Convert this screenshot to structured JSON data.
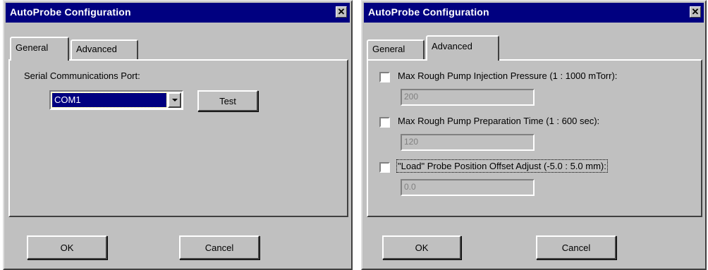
{
  "dialog_general": {
    "title": "AutoProbe Configuration",
    "close_glyph": "✕",
    "tabs": [
      {
        "label": "General",
        "active": true
      },
      {
        "label": "Advanced",
        "active": false
      }
    ],
    "port_label": "Serial Communications Port:",
    "port_value": "COM1",
    "test_label": "Test",
    "ok_label": "OK",
    "cancel_label": "Cancel"
  },
  "dialog_advanced": {
    "title": "AutoProbe Configuration",
    "close_glyph": "✕",
    "tabs": [
      {
        "label": "General",
        "active": false
      },
      {
        "label": "Advanced",
        "active": true
      }
    ],
    "options": [
      {
        "label": "Max Rough Pump Injection Pressure (1 : 1000 mTorr):",
        "value": "200",
        "checked": false
      },
      {
        "label": "Max Rough Pump Preparation Time (1 : 600 sec):",
        "value": "120",
        "checked": false
      },
      {
        "label": "\"Load\" Probe Position Offset Adjust (-5.0 : 5.0 mm):",
        "value": "0.0",
        "checked": false
      }
    ],
    "ok_label": "OK",
    "cancel_label": "Cancel"
  },
  "colors": {
    "title_bar": "#000080",
    "face": "#c0c0c0",
    "selection": "#000080",
    "disabled_text": "#808080"
  }
}
